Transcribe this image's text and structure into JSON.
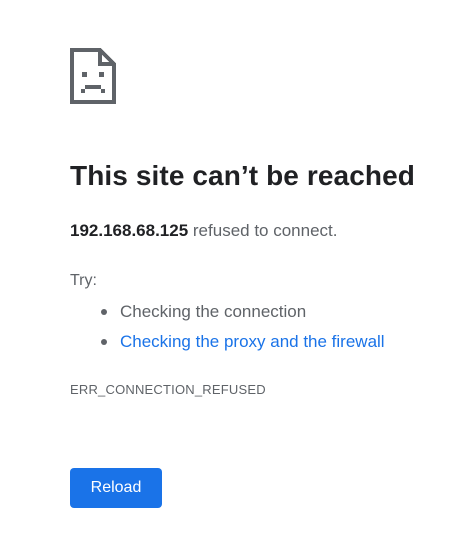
{
  "error_page": {
    "icon": "sad-document-icon",
    "title": "This site can’t be reached",
    "host": "192.168.68.125",
    "message_suffix": " refused to connect.",
    "try_label": "Try:",
    "suggestions": [
      {
        "label": "Checking the connection",
        "is_link": false
      },
      {
        "label": "Checking the proxy and the firewall",
        "is_link": true
      }
    ],
    "error_code": "ERR_CONNECTION_REFUSED",
    "reload_label": "Reload"
  },
  "colors": {
    "title": "#202124",
    "body_text": "#5f6368",
    "link": "#1a73e8",
    "button_bg": "#1a73e8",
    "button_text": "#ffffff"
  }
}
